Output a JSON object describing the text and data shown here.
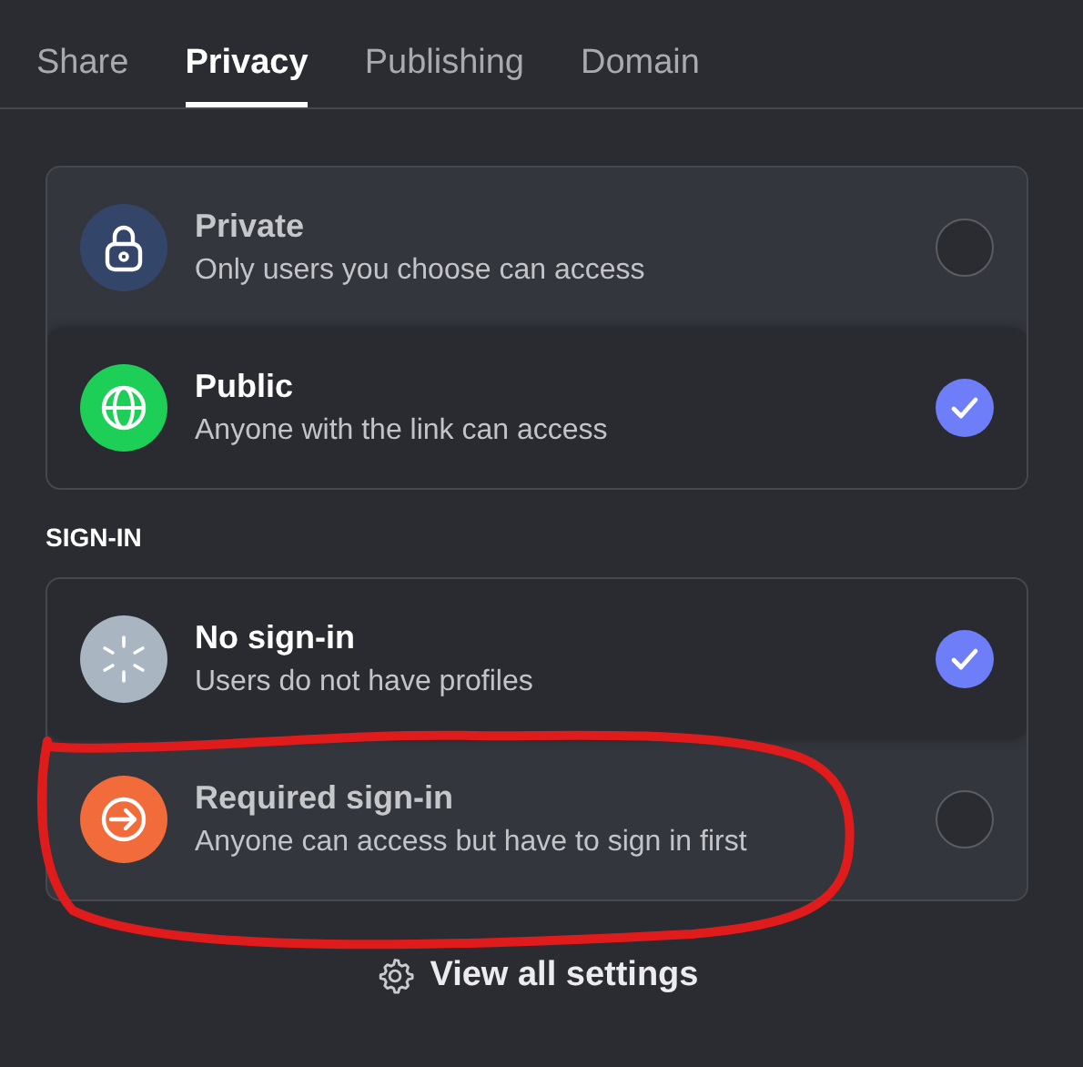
{
  "tabs": [
    {
      "label": "Share",
      "selected": false
    },
    {
      "label": "Privacy",
      "selected": true
    },
    {
      "label": "Publishing",
      "selected": false
    },
    {
      "label": "Domain",
      "selected": false
    }
  ],
  "access_options": [
    {
      "kind": "lock",
      "color": "#34456a",
      "title": "Private",
      "description": "Only users you choose can access",
      "selected": false
    },
    {
      "kind": "globe",
      "color": "#1ecf57",
      "title": "Public",
      "description": "Anyone with the link can access",
      "selected": true
    }
  ],
  "sign_in_heading": "SIGN-IN",
  "sign_in_options": [
    {
      "kind": "spinner",
      "color": "#a9b5c0",
      "title": "No sign-in",
      "description": "Users do not have profiles",
      "selected": true
    },
    {
      "kind": "arrow",
      "color": "#f26b3a",
      "title": "Required sign-in",
      "description": "Anyone can access but have to sign in first",
      "selected": false
    }
  ],
  "settings_button": "View all settings"
}
